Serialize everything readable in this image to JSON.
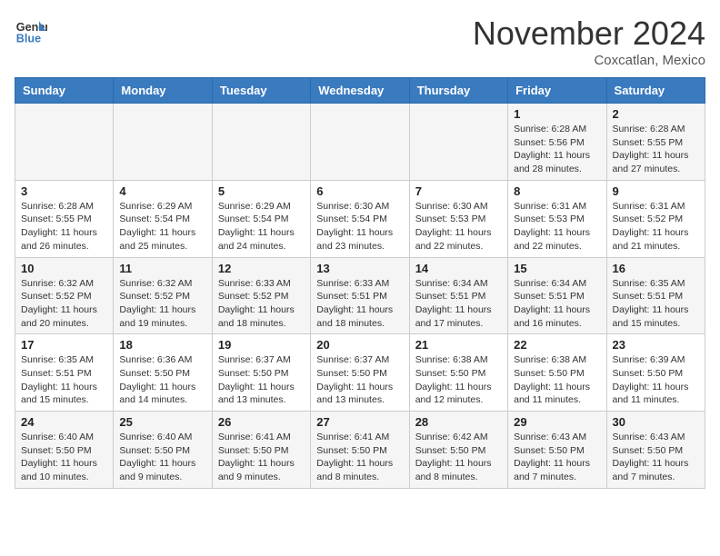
{
  "header": {
    "logo_line1": "General",
    "logo_line2": "Blue",
    "month_title": "November 2024",
    "location": "Coxcatlan, Mexico"
  },
  "weekdays": [
    "Sunday",
    "Monday",
    "Tuesday",
    "Wednesday",
    "Thursday",
    "Friday",
    "Saturday"
  ],
  "weeks": [
    [
      {
        "day": "",
        "detail": ""
      },
      {
        "day": "",
        "detail": ""
      },
      {
        "day": "",
        "detail": ""
      },
      {
        "day": "",
        "detail": ""
      },
      {
        "day": "",
        "detail": ""
      },
      {
        "day": "1",
        "detail": "Sunrise: 6:28 AM\nSunset: 5:56 PM\nDaylight: 11 hours\nand 28 minutes."
      },
      {
        "day": "2",
        "detail": "Sunrise: 6:28 AM\nSunset: 5:55 PM\nDaylight: 11 hours\nand 27 minutes."
      }
    ],
    [
      {
        "day": "3",
        "detail": "Sunrise: 6:28 AM\nSunset: 5:55 PM\nDaylight: 11 hours\nand 26 minutes."
      },
      {
        "day": "4",
        "detail": "Sunrise: 6:29 AM\nSunset: 5:54 PM\nDaylight: 11 hours\nand 25 minutes."
      },
      {
        "day": "5",
        "detail": "Sunrise: 6:29 AM\nSunset: 5:54 PM\nDaylight: 11 hours\nand 24 minutes."
      },
      {
        "day": "6",
        "detail": "Sunrise: 6:30 AM\nSunset: 5:54 PM\nDaylight: 11 hours\nand 23 minutes."
      },
      {
        "day": "7",
        "detail": "Sunrise: 6:30 AM\nSunset: 5:53 PM\nDaylight: 11 hours\nand 22 minutes."
      },
      {
        "day": "8",
        "detail": "Sunrise: 6:31 AM\nSunset: 5:53 PM\nDaylight: 11 hours\nand 22 minutes."
      },
      {
        "day": "9",
        "detail": "Sunrise: 6:31 AM\nSunset: 5:52 PM\nDaylight: 11 hours\nand 21 minutes."
      }
    ],
    [
      {
        "day": "10",
        "detail": "Sunrise: 6:32 AM\nSunset: 5:52 PM\nDaylight: 11 hours\nand 20 minutes."
      },
      {
        "day": "11",
        "detail": "Sunrise: 6:32 AM\nSunset: 5:52 PM\nDaylight: 11 hours\nand 19 minutes."
      },
      {
        "day": "12",
        "detail": "Sunrise: 6:33 AM\nSunset: 5:52 PM\nDaylight: 11 hours\nand 18 minutes."
      },
      {
        "day": "13",
        "detail": "Sunrise: 6:33 AM\nSunset: 5:51 PM\nDaylight: 11 hours\nand 18 minutes."
      },
      {
        "day": "14",
        "detail": "Sunrise: 6:34 AM\nSunset: 5:51 PM\nDaylight: 11 hours\nand 17 minutes."
      },
      {
        "day": "15",
        "detail": "Sunrise: 6:34 AM\nSunset: 5:51 PM\nDaylight: 11 hours\nand 16 minutes."
      },
      {
        "day": "16",
        "detail": "Sunrise: 6:35 AM\nSunset: 5:51 PM\nDaylight: 11 hours\nand 15 minutes."
      }
    ],
    [
      {
        "day": "17",
        "detail": "Sunrise: 6:35 AM\nSunset: 5:51 PM\nDaylight: 11 hours\nand 15 minutes."
      },
      {
        "day": "18",
        "detail": "Sunrise: 6:36 AM\nSunset: 5:50 PM\nDaylight: 11 hours\nand 14 minutes."
      },
      {
        "day": "19",
        "detail": "Sunrise: 6:37 AM\nSunset: 5:50 PM\nDaylight: 11 hours\nand 13 minutes."
      },
      {
        "day": "20",
        "detail": "Sunrise: 6:37 AM\nSunset: 5:50 PM\nDaylight: 11 hours\nand 13 minutes."
      },
      {
        "day": "21",
        "detail": "Sunrise: 6:38 AM\nSunset: 5:50 PM\nDaylight: 11 hours\nand 12 minutes."
      },
      {
        "day": "22",
        "detail": "Sunrise: 6:38 AM\nSunset: 5:50 PM\nDaylight: 11 hours\nand 11 minutes."
      },
      {
        "day": "23",
        "detail": "Sunrise: 6:39 AM\nSunset: 5:50 PM\nDaylight: 11 hours\nand 11 minutes."
      }
    ],
    [
      {
        "day": "24",
        "detail": "Sunrise: 6:40 AM\nSunset: 5:50 PM\nDaylight: 11 hours\nand 10 minutes."
      },
      {
        "day": "25",
        "detail": "Sunrise: 6:40 AM\nSunset: 5:50 PM\nDaylight: 11 hours\nand 9 minutes."
      },
      {
        "day": "26",
        "detail": "Sunrise: 6:41 AM\nSunset: 5:50 PM\nDaylight: 11 hours\nand 9 minutes."
      },
      {
        "day": "27",
        "detail": "Sunrise: 6:41 AM\nSunset: 5:50 PM\nDaylight: 11 hours\nand 8 minutes."
      },
      {
        "day": "28",
        "detail": "Sunrise: 6:42 AM\nSunset: 5:50 PM\nDaylight: 11 hours\nand 8 minutes."
      },
      {
        "day": "29",
        "detail": "Sunrise: 6:43 AM\nSunset: 5:50 PM\nDaylight: 11 hours\nand 7 minutes."
      },
      {
        "day": "30",
        "detail": "Sunrise: 6:43 AM\nSunset: 5:50 PM\nDaylight: 11 hours\nand 7 minutes."
      }
    ]
  ]
}
